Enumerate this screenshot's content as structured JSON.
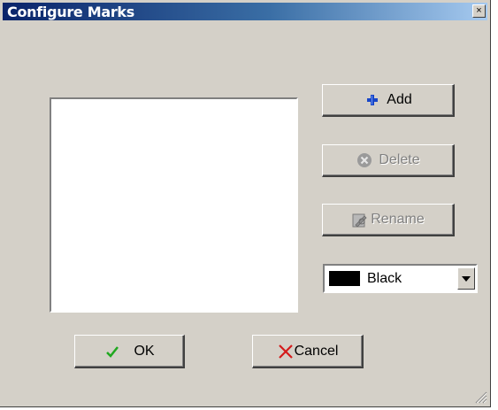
{
  "window": {
    "title": "Configure Marks",
    "close_glyph": "×"
  },
  "buttons": {
    "add": {
      "label": "Add",
      "icon": "plus-icon"
    },
    "delete": {
      "label": "Delete",
      "icon": "delete-circle-icon",
      "disabled": true
    },
    "rename": {
      "label": "Rename",
      "icon": "rename-icon",
      "disabled": true
    },
    "ok": {
      "label": "OK",
      "icon": "checkmark-icon"
    },
    "cancel": {
      "label": "Cancel",
      "icon": "red-x-icon"
    }
  },
  "color_select": {
    "value": "Black",
    "swatch_color": "#000000"
  },
  "marks_list": {
    "items": []
  }
}
